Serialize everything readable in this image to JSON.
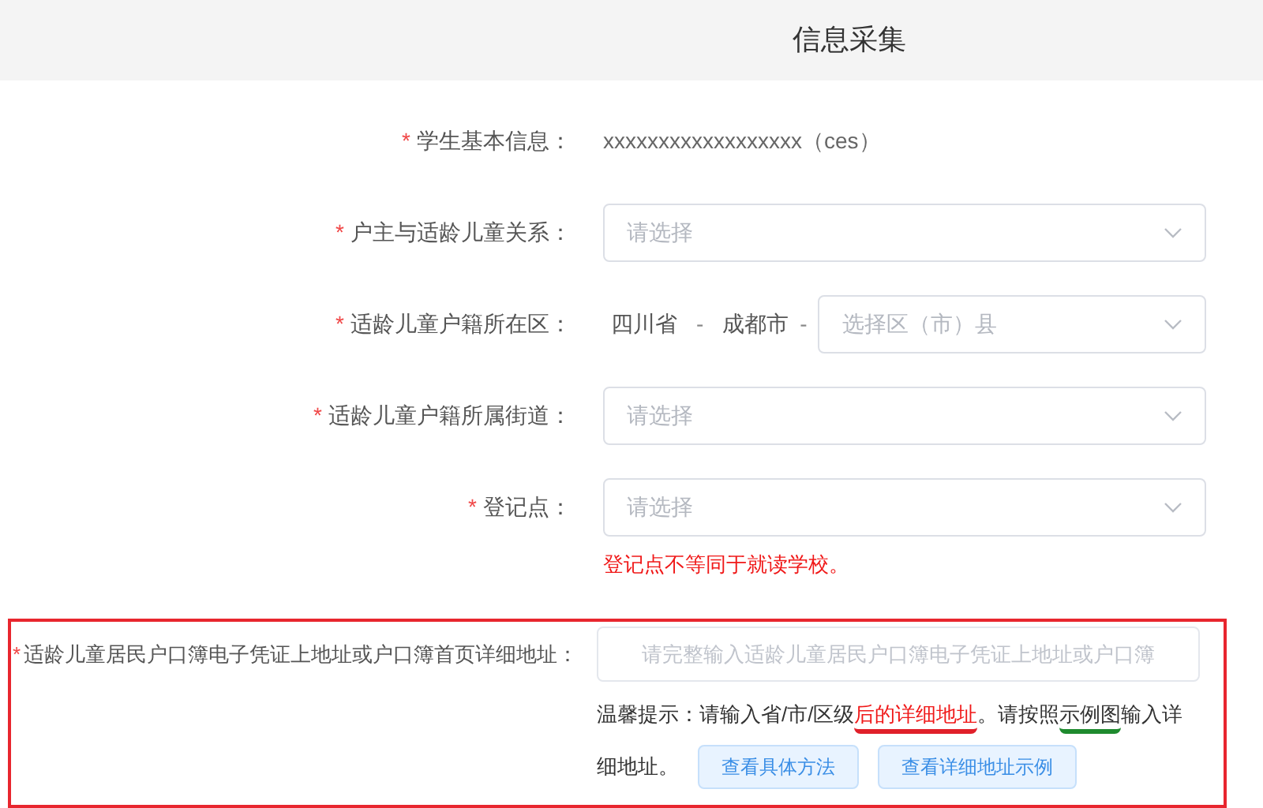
{
  "header": {
    "title": "信息采集"
  },
  "fields": [
    {
      "kind": "text",
      "required_mark": "*",
      "label": "学生基本信息：",
      "value": "xxxxxxxxxxxxxxxxxx（ces）"
    },
    {
      "kind": "select",
      "required_mark": "*",
      "label": "户主与适龄儿童关系：",
      "placeholder": "请选择"
    },
    {
      "kind": "region",
      "required_mark": "*",
      "label": "适龄儿童户籍所在区：",
      "province": "四川省",
      "separator_1": "-",
      "city": "成都市",
      "separator_2": "-",
      "placeholder": "选择区（市）县"
    },
    {
      "kind": "select",
      "required_mark": "*",
      "label": "适龄儿童户籍所属街道：",
      "placeholder": "请选择"
    },
    {
      "kind": "select",
      "required_mark": "*",
      "label": "登记点：",
      "placeholder": "请选择",
      "note": "登记点不等同于就读学校。"
    }
  ],
  "address": {
    "highlighted": true,
    "required_mark": "*",
    "label": "适龄儿童居民户口簿电子凭证上地址或户口簿首页详细地址：",
    "placeholder": "请完整输入适龄儿童居民户口簿电子凭证上地址或户口簿",
    "hint": [
      {
        "text": "温馨提示：请输入省/市/区级",
        "red": false
      },
      {
        "text": "后的详细地址",
        "red": true,
        "color": "#e0202a"
      },
      {
        "text": "。请按照",
        "red": false
      },
      {
        "text": "示例图",
        "red": false,
        "color": "#1e8a2e"
      },
      {
        "text": "输入详",
        "red": false
      }
    ],
    "hint_continued": "细地址。",
    "buttons": [
      "查看具体方法",
      "查看详细地址示例"
    ]
  }
}
